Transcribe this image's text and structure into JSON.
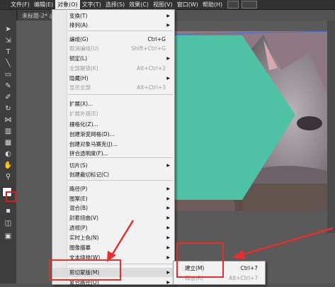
{
  "menubar": {
    "items": [
      "文件(F)",
      "编辑(E)",
      "对象(O)",
      "文字(T)",
      "选择(S)",
      "效果(C)",
      "视图(V)",
      "窗口(W)",
      "帮助(H)"
    ],
    "active_index": 2
  },
  "document_tab": {
    "title": "未标题-2* @"
  },
  "object_menu": {
    "items": [
      {
        "label": "变换(T)",
        "shortcut": "",
        "submenu": true,
        "disabled": false
      },
      {
        "label": "排列(A)",
        "shortcut": "",
        "submenu": true,
        "disabled": false
      },
      {
        "label": "编组(G)",
        "shortcut": "Ctrl+G",
        "submenu": false,
        "disabled": false
      },
      {
        "label": "取消编组(U)",
        "shortcut": "Shift+Ctrl+G",
        "submenu": false,
        "disabled": true
      },
      {
        "label": "锁定(L)",
        "shortcut": "",
        "submenu": true,
        "disabled": false
      },
      {
        "label": "全部解锁(K)",
        "shortcut": "Alt+Ctrl+2",
        "submenu": false,
        "disabled": true
      },
      {
        "label": "隐藏(H)",
        "shortcut": "",
        "submenu": true,
        "disabled": false
      },
      {
        "label": "显示全部",
        "shortcut": "Alt+Ctrl+3",
        "submenu": false,
        "disabled": true
      },
      {
        "label": "扩展(X)...",
        "shortcut": "",
        "submenu": false,
        "disabled": false
      },
      {
        "label": "扩展外观(E)",
        "shortcut": "",
        "submenu": false,
        "disabled": true
      },
      {
        "label": "栅格化(Z)...",
        "shortcut": "",
        "submenu": false,
        "disabled": false
      },
      {
        "label": "创建渐变网格(D)...",
        "shortcut": "",
        "submenu": false,
        "disabled": false
      },
      {
        "label": "创建对象马赛克(J)...",
        "shortcut": "",
        "submenu": false,
        "disabled": false
      },
      {
        "label": "拼合透明度(F)...",
        "shortcut": "",
        "submenu": false,
        "disabled": false
      },
      {
        "label": "切片(S)",
        "shortcut": "",
        "submenu": true,
        "disabled": false
      },
      {
        "label": "创建裁切标记(C)",
        "shortcut": "",
        "submenu": false,
        "disabled": false
      },
      {
        "label": "路径(P)",
        "shortcut": "",
        "submenu": true,
        "disabled": false
      },
      {
        "label": "图案(E)",
        "shortcut": "",
        "submenu": true,
        "disabled": false
      },
      {
        "label": "混合(B)",
        "shortcut": "",
        "submenu": true,
        "disabled": false
      },
      {
        "label": "封套扭曲(V)",
        "shortcut": "",
        "submenu": true,
        "disabled": false
      },
      {
        "label": "透视(P)",
        "shortcut": "",
        "submenu": true,
        "disabled": false
      },
      {
        "label": "实时上色(N)",
        "shortcut": "",
        "submenu": true,
        "disabled": false
      },
      {
        "label": "图像描摹",
        "shortcut": "",
        "submenu": true,
        "disabled": false
      },
      {
        "label": "文本绕排(W)",
        "shortcut": "",
        "submenu": true,
        "disabled": false
      },
      {
        "label": "剪切蒙版(M)",
        "shortcut": "",
        "submenu": true,
        "disabled": false,
        "highlighted": true
      },
      {
        "label": "复合路径(O)",
        "shortcut": "",
        "submenu": true,
        "disabled": false
      }
    ]
  },
  "clipping_submenu": {
    "items": [
      {
        "label": "建立(M)",
        "shortcut": "Ctrl+7",
        "disabled": false
      },
      {
        "label": "释放(R)",
        "shortcut": "Alt+Ctrl+7",
        "disabled": true
      }
    ]
  },
  "colors": {
    "teal": "#4fc2a6",
    "annotation_red": "#e23030",
    "menubar_bg": "#323232",
    "menu_bg": "#f2f2f2"
  }
}
